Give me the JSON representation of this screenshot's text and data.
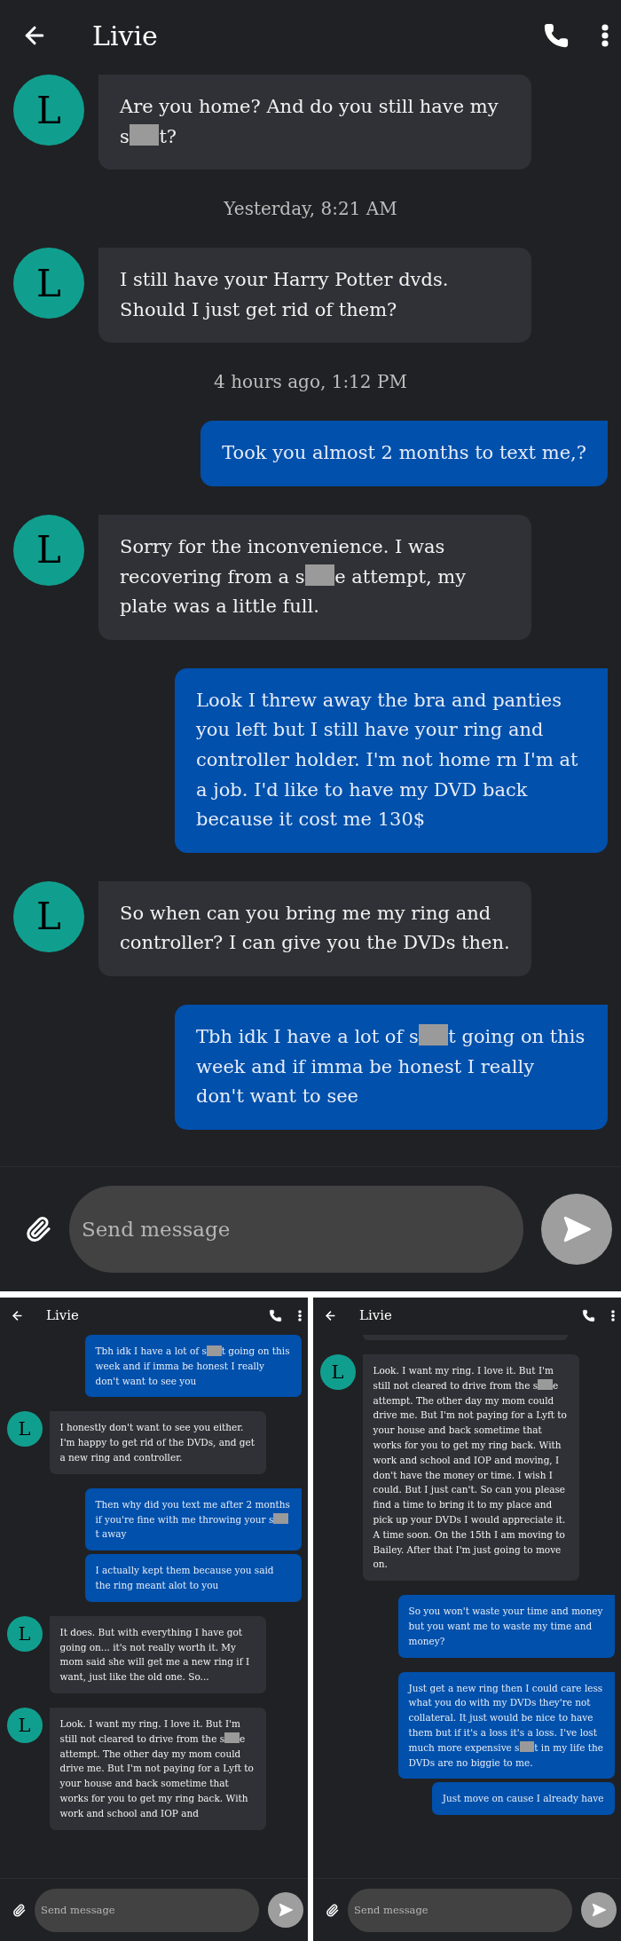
{
  "screens": [
    {
      "title": "Livie",
      "composer": {
        "placeholder": "Send message"
      },
      "messages": [
        {
          "kind": "incoming",
          "avatar": "L",
          "tail": true,
          "parts": [
            {
              "kind": "text",
              "text": "Are you home? And do you still have my s"
            },
            {
              "kind": "redaction"
            },
            {
              "kind": "text",
              "text": "t?"
            }
          ]
        },
        {
          "kind": "timestamp",
          "text": "Yesterday, 8:21 AM"
        },
        {
          "kind": "incoming",
          "avatar": "L",
          "tail": true,
          "parts": [
            {
              "kind": "text",
              "text": "I still have your Harry Potter dvds. Should I just get rid of them?"
            }
          ]
        },
        {
          "kind": "timestamp",
          "text": "4 hours ago, 1:12 PM"
        },
        {
          "kind": "outgoing",
          "tail": true,
          "parts": [
            {
              "kind": "text",
              "text": "Took you almost 2 months to text me,?"
            }
          ]
        },
        {
          "kind": "incoming",
          "avatar": "L",
          "tail": true,
          "parts": [
            {
              "kind": "text",
              "text": "Sorry for the inconvenience. I was recovering from a s"
            },
            {
              "kind": "redaction"
            },
            {
              "kind": "text",
              "text": "e attempt, my plate was a little full."
            }
          ]
        },
        {
          "kind": "outgoing",
          "tail": true,
          "parts": [
            {
              "kind": "text",
              "text": "Look I threw away the bra and panties you left but I still have your ring and controller holder. I'm not home rn I'm at a job. I'd like to have my DVD back because it cost me 130$"
            }
          ]
        },
        {
          "kind": "incoming",
          "avatar": "L",
          "tail": true,
          "parts": [
            {
              "kind": "text",
              "text": "So when can you bring me my ring and controller? I can give you the DVDs then."
            }
          ]
        },
        {
          "kind": "outgoing",
          "tail": true,
          "parts": [
            {
              "kind": "text",
              "text": "Tbh idk I have a lot of s"
            },
            {
              "kind": "redaction"
            },
            {
              "kind": "text",
              "text": "t going on this week and if imma be honest I really don't want to see"
            }
          ]
        }
      ]
    },
    {
      "title": "Livie",
      "composer": {
        "placeholder": "Send message"
      },
      "messages": [
        {
          "kind": "outgoing",
          "tail": false,
          "parts": [
            {
              "kind": "text",
              "text": "Tbh idk I have a lot of s"
            },
            {
              "kind": "redaction"
            },
            {
              "kind": "text",
              "text": "t going on this week and if imma be honest I really don't want to see you"
            }
          ]
        },
        {
          "kind": "incoming",
          "avatar": "L",
          "tail": true,
          "parts": [
            {
              "kind": "text",
              "text": "I honestly don't want to see you either. I'm happy to get rid of the DVDs, and get a new ring and controller."
            }
          ]
        },
        {
          "kind": "outgoing",
          "tail": true,
          "parts": [
            {
              "kind": "text",
              "text": "Then why did you text me after 2 months if you're fine with me throwing your s"
            },
            {
              "kind": "redaction"
            },
            {
              "kind": "text",
              "text": "t away"
            }
          ]
        },
        {
          "kind": "outgoing",
          "tail": false,
          "parts": [
            {
              "kind": "text",
              "text": "I actually kept them because you said the ring meant alot to you"
            }
          ]
        },
        {
          "kind": "incoming",
          "avatar": "L",
          "tail": true,
          "parts": [
            {
              "kind": "text",
              "text": "It does. But with everything I have got going on... it's not really worth it. My mom said she will get me a new ring if I want, just like the old one. So..."
            }
          ]
        },
        {
          "kind": "incoming",
          "avatar": "L",
          "tail": true,
          "parts": [
            {
              "kind": "text",
              "text": "Look. I want my ring. I love it. But I'm still not cleared to drive from the s"
            },
            {
              "kind": "redaction"
            },
            {
              "kind": "text",
              "text": "e attempt. The other day my mom could drive me. But I'm not paying for a Lyft to your house and back sometime that works for you to get my ring back. With work and school and IOP and"
            }
          ]
        }
      ]
    },
    {
      "title": "Livie",
      "composer": {
        "placeholder": "Send message"
      },
      "messages": [
        {
          "kind": "clipped"
        },
        {
          "kind": "incoming",
          "avatar": "L",
          "tail": true,
          "parts": [
            {
              "kind": "text",
              "text": "Look. I want my ring. I love it. But I'm still not cleared to drive from the s"
            },
            {
              "kind": "redaction"
            },
            {
              "kind": "text",
              "text": "e attempt. The other day my mom could drive me. But I'm not paying for a Lyft to your house and back sometime that works for you to get my ring back. With work and school and IOP and moving, I don't have the money or time. I wish I could. But I just can't. So can you please find a time to bring it to my place and pick up your DVDs I would appreciate it. A time soon. On the 15th I am moving to Bailey. After that I'm just going to move on."
            }
          ]
        },
        {
          "kind": "outgoing",
          "tail": true,
          "parts": [
            {
              "kind": "text",
              "text": "So you won't waste your time and money but you want me to waste my time and money?"
            }
          ]
        },
        {
          "kind": "outgoing",
          "tail": true,
          "parts": [
            {
              "kind": "text",
              "text": "Just get a new ring then I could care less what you do with my DVDs they're not collateral. It just would be nice to have them but if it's a loss it's a loss. I've lost much more expensive s"
            },
            {
              "kind": "redaction"
            },
            {
              "kind": "text",
              "text": "t in my life the DVDs are no biggie to me."
            }
          ]
        },
        {
          "kind": "outgoing",
          "tail": false,
          "parts": [
            {
              "kind": "text",
              "text": "Just move on cause I already have"
            }
          ]
        }
      ]
    }
  ]
}
